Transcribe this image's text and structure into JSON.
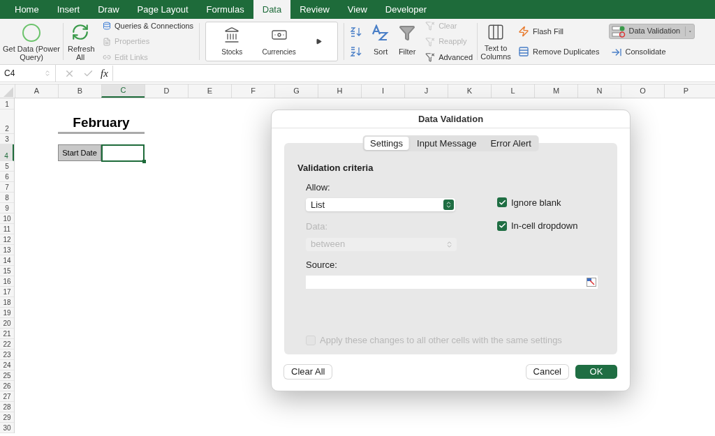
{
  "ribbon_tabs": [
    {
      "label": "Home",
      "selected": false
    },
    {
      "label": "Insert",
      "selected": false
    },
    {
      "label": "Draw",
      "selected": false
    },
    {
      "label": "Page Layout",
      "selected": false
    },
    {
      "label": "Formulas",
      "selected": false
    },
    {
      "label": "Data",
      "selected": true
    },
    {
      "label": "Review",
      "selected": false
    },
    {
      "label": "View",
      "selected": false
    },
    {
      "label": "Developer",
      "selected": false
    }
  ],
  "ribbon": {
    "get_data": {
      "label": "Get Data (Power Query)"
    },
    "refresh": {
      "label": "Refresh All"
    },
    "query_items": [
      {
        "label": "Queries & Connections",
        "disabled": false
      },
      {
        "label": "Properties",
        "disabled": true
      },
      {
        "label": "Edit Links",
        "disabled": true
      }
    ],
    "data_types": [
      {
        "label": "Stocks"
      },
      {
        "label": "Currencies"
      }
    ],
    "sort": {
      "label": "Sort"
    },
    "filter": {
      "label": "Filter"
    },
    "filter_items": [
      {
        "label": "Clear",
        "disabled": true
      },
      {
        "label": "Reapply",
        "disabled": true
      },
      {
        "label": "Advanced",
        "disabled": false
      }
    ],
    "text_to_columns": {
      "label": "Text to Columns"
    },
    "tools": [
      {
        "label": "Flash Fill"
      },
      {
        "label": "Remove Duplicates"
      }
    ],
    "validation": [
      {
        "label": "Data Validation",
        "selected": true
      },
      {
        "label": "Consolidate",
        "selected": false
      }
    ]
  },
  "name_box": "C4",
  "formula_label": "fx",
  "sheet": {
    "columns": [
      {
        "label": "A",
        "selected": false
      },
      {
        "label": "B",
        "selected": false
      },
      {
        "label": "C",
        "selected": true
      },
      {
        "label": "D",
        "selected": false
      },
      {
        "label": "E",
        "selected": false
      },
      {
        "label": "F",
        "selected": false
      },
      {
        "label": "G",
        "selected": false
      },
      {
        "label": "H",
        "selected": false
      },
      {
        "label": "I",
        "selected": false
      },
      {
        "label": "J",
        "selected": false
      },
      {
        "label": "K",
        "selected": false
      },
      {
        "label": "L",
        "selected": false
      },
      {
        "label": "M",
        "selected": false
      },
      {
        "label": "N",
        "selected": false
      },
      {
        "label": "O",
        "selected": false
      },
      {
        "label": "P",
        "selected": false
      }
    ],
    "rows": [
      {
        "label": "1",
        "selected": false
      },
      {
        "label": "2",
        "selected": false
      },
      {
        "label": "3",
        "selected": false
      },
      {
        "label": "4",
        "selected": true
      },
      {
        "label": "5",
        "selected": false
      },
      {
        "label": "6",
        "selected": false
      },
      {
        "label": "7",
        "selected": false
      },
      {
        "label": "8",
        "selected": false
      },
      {
        "label": "9",
        "selected": false
      },
      {
        "label": "10",
        "selected": false
      },
      {
        "label": "11",
        "selected": false
      },
      {
        "label": "12",
        "selected": false
      },
      {
        "label": "13",
        "selected": false
      },
      {
        "label": "14",
        "selected": false
      },
      {
        "label": "15",
        "selected": false
      },
      {
        "label": "16",
        "selected": false
      },
      {
        "label": "17",
        "selected": false
      },
      {
        "label": "18",
        "selected": false
      },
      {
        "label": "19",
        "selected": false
      },
      {
        "label": "20",
        "selected": false
      },
      {
        "label": "21",
        "selected": false
      },
      {
        "label": "22",
        "selected": false
      },
      {
        "label": "23",
        "selected": false
      },
      {
        "label": "24",
        "selected": false
      },
      {
        "label": "25",
        "selected": false
      },
      {
        "label": "26",
        "selected": false
      },
      {
        "label": "27",
        "selected": false
      },
      {
        "label": "28",
        "selected": false
      },
      {
        "label": "29",
        "selected": false
      },
      {
        "label": "30",
        "selected": false
      }
    ],
    "title": "February",
    "label_cell": "Start Date"
  },
  "dialog": {
    "title": "Data Validation",
    "tabs": [
      {
        "label": "Settings",
        "selected": true
      },
      {
        "label": "Input Message",
        "selected": false
      },
      {
        "label": "Error Alert",
        "selected": false
      }
    ],
    "section": "Validation criteria",
    "allow": {
      "label": "Allow:",
      "value": "List"
    },
    "data": {
      "label": "Data:",
      "value": "between",
      "disabled": true
    },
    "options": [
      {
        "label": "Ignore blank",
        "checked": true
      },
      {
        "label": "In-cell dropdown",
        "checked": true
      }
    ],
    "source": {
      "label": "Source:"
    },
    "apply": {
      "label": "Apply these changes to all other cells with the same settings",
      "checked": false,
      "disabled": true
    },
    "buttons": [
      {
        "label": "Clear All",
        "kind": "plain"
      },
      {
        "label": "Cancel",
        "kind": "plain"
      },
      {
        "label": "OK",
        "kind": "primary"
      }
    ]
  }
}
